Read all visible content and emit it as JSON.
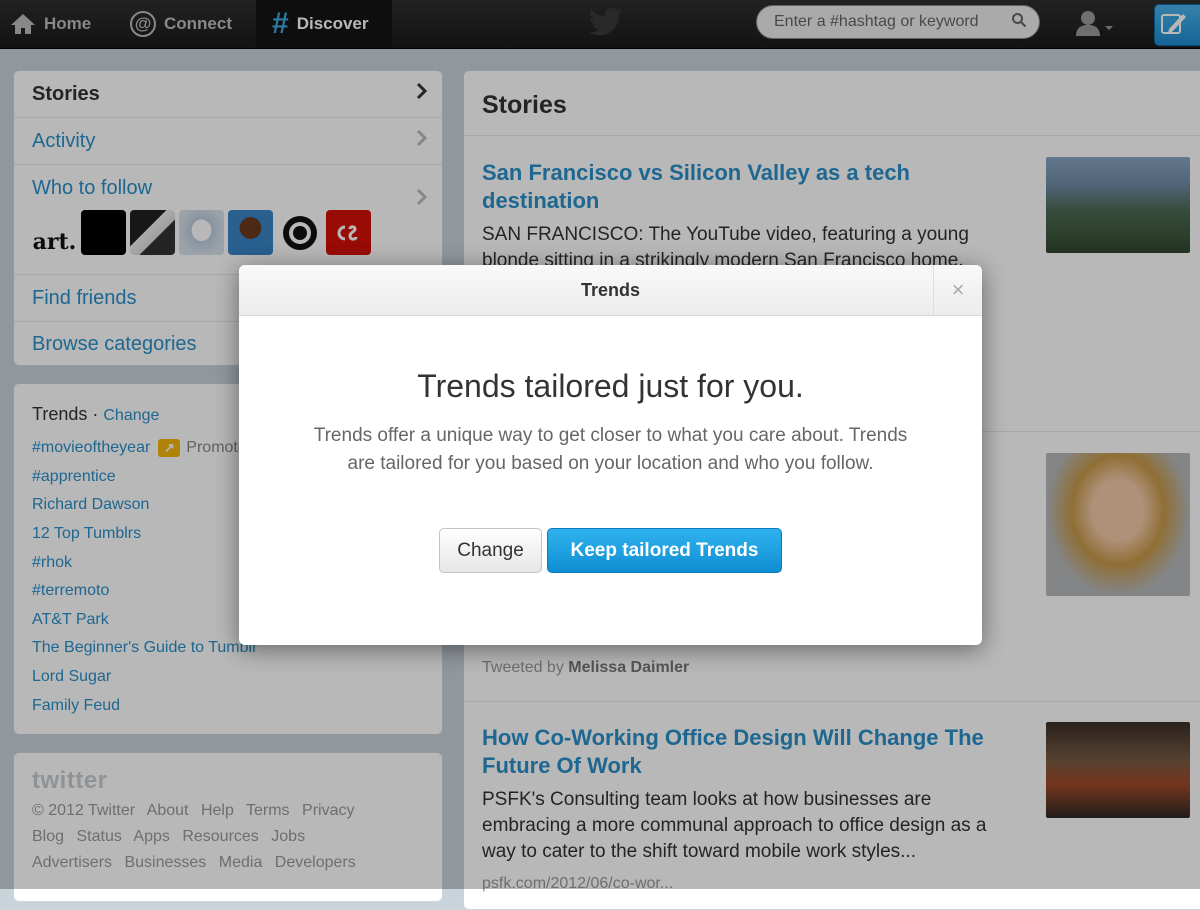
{
  "topbar": {
    "nav": [
      {
        "label": "Home",
        "icon": "home-icon"
      },
      {
        "label": "Connect",
        "icon": "at-icon"
      },
      {
        "label": "Discover",
        "icon": "hash-icon"
      }
    ],
    "search_placeholder": "Enter a #hashtag or keyword",
    "colors": {
      "bar": "#1f1f1f",
      "accent": "#3fa8e0",
      "compose": "#1d8bd1"
    }
  },
  "left_nav": {
    "items": [
      {
        "label": "Stories"
      },
      {
        "label": "Activity"
      },
      {
        "label": "Who to follow"
      },
      {
        "label": "Find friends"
      },
      {
        "label": "Browse categories"
      }
    ],
    "avatar_art_text": "art."
  },
  "trends": {
    "heading": "Trends",
    "separator": "·",
    "change_label": "Change",
    "promoted_label": "Promoted",
    "items": [
      "#movieoftheyear",
      "#apprentice",
      "Richard Dawson",
      "12 Top Tumblrs",
      "#rhok",
      "#terremoto",
      "AT&T Park",
      "The Beginner's Guide to Tumblr",
      "Lord Sugar",
      "Family Feud"
    ]
  },
  "footer": {
    "logo": "twitter",
    "line1": [
      "© 2012 Twitter",
      "About",
      "Help",
      "Terms",
      "Privacy"
    ],
    "line2": [
      "Blog",
      "Status",
      "Apps",
      "Resources",
      "Jobs"
    ],
    "line3": [
      "Advertisers",
      "Businesses",
      "Media",
      "Developers"
    ]
  },
  "main": {
    "title": "Stories",
    "story1": {
      "title": "San Francisco vs Silicon Valley as a tech destination",
      "text_line1": "SAN FRANCISCO: The YouTube video, featuring a young",
      "text_line2": "blonde sitting in a strikingly modern San Francisco home,"
    },
    "story2": {
      "tweeted_prefix": "Tweeted by",
      "tweeted_by": "Melissa Daimler"
    },
    "story3": {
      "title": "How Co-Working Office Design Will Change The Future Of Work",
      "text": "PSFK's Consulting team looks at how businesses are embracing a more communal approach to office design as a way to cater to the shift toward mobile work styles...",
      "link": "psfk.com/2012/06/co-wor..."
    }
  },
  "modal": {
    "header": "Trends",
    "close": "×",
    "heading": "Trends tailored just for you.",
    "description": "Trends offer a unique way to get closer to what you care about. Trends are tailored for you based on your location and who you follow.",
    "change_button": "Change",
    "keep_button": "Keep tailored Trends"
  }
}
